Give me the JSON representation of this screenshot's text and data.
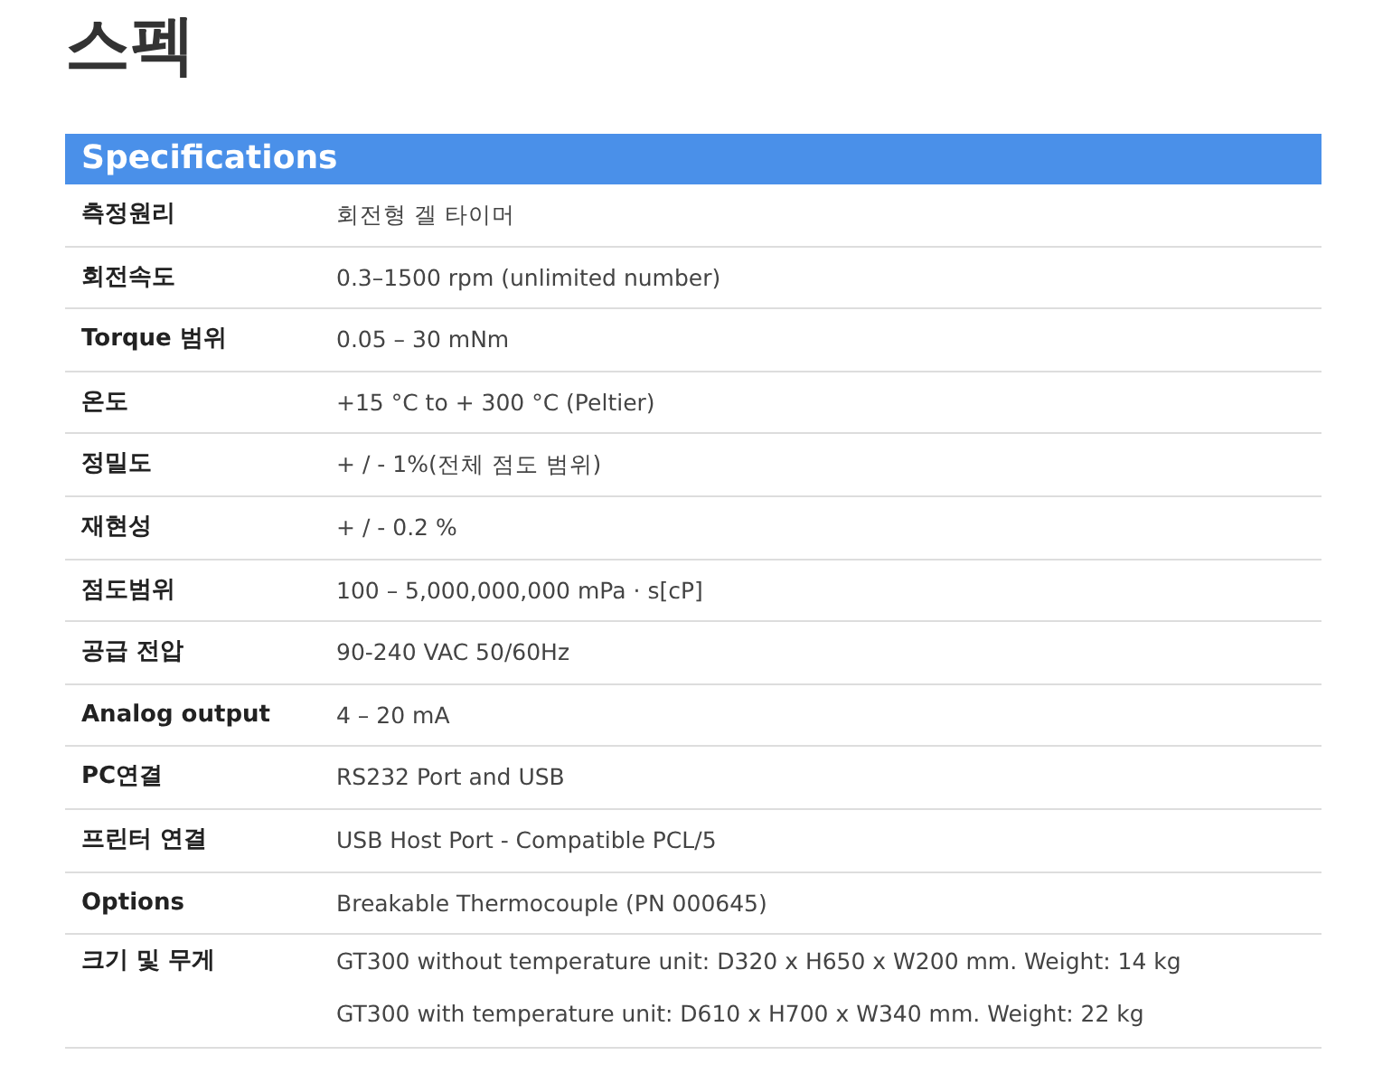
{
  "page_title": "스펙",
  "table": {
    "header": "Specifications",
    "rows": [
      {
        "label": "측정원리",
        "values": [
          "회전형 겔 타이머"
        ]
      },
      {
        "label": "회전속도",
        "values": [
          "0.3–1500 rpm (unlimited number)"
        ]
      },
      {
        "label": "Torque 범위",
        "values": [
          "0.05 – 30 mNm"
        ]
      },
      {
        "label": "온도",
        "values": [
          "+15 °C to + 300 °C (Peltier)"
        ]
      },
      {
        "label": "정밀도",
        "values": [
          "+ / - 1%(전체 점도 범위)"
        ]
      },
      {
        "label": "재현성",
        "values": [
          "+ / - 0.2 %"
        ]
      },
      {
        "label": "점도범위",
        "values": [
          "100 – 5,000,000,000 mPa · s[cP]"
        ]
      },
      {
        "label": "공급 전압",
        "values": [
          "90-240 VAC 50/60Hz"
        ]
      },
      {
        "label": "Analog output",
        "values": [
          "4 – 20 mA"
        ]
      },
      {
        "label": "PC연결",
        "values": [
          "RS232 Port and USB"
        ]
      },
      {
        "label": "프린터 연결",
        "values": [
          "USB Host Port - Compatible PCL/5"
        ]
      },
      {
        "label": "Options",
        "values": [
          "Breakable Thermocouple (PN 000645)"
        ]
      },
      {
        "label": "크기 및 무게",
        "values": [
          "GT300 without temperature unit: D320 x H650 x W200 mm. Weight: 14 kg",
          "GT300 with temperature unit: D610 x H700 x W340 mm. Weight: 22 kg"
        ]
      }
    ]
  }
}
